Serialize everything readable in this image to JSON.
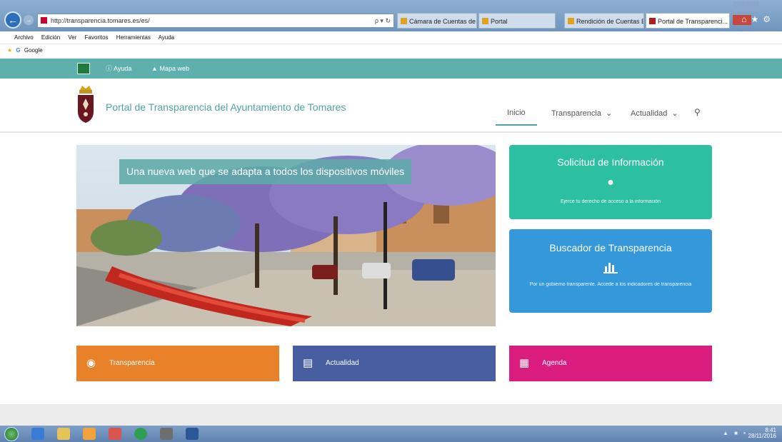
{
  "browser": {
    "address_url": "http://transparencia.tomares.es/es/",
    "address_controls": "ρ ▾ ↻",
    "tabs": [
      {
        "label": "Cámara de Cuentas de A..."
      },
      {
        "label": "Portal"
      },
      {
        "label": "Rendición de Cuentas Entid..."
      },
      {
        "label": "Portal de Transparenci..."
      }
    ],
    "menu": [
      "Archivo",
      "Edición",
      "Ver",
      "Favoritos",
      "Herramientas",
      "Ayuda"
    ],
    "favorites": [
      "Google"
    ]
  },
  "topbar": {
    "help_label": "Ayuda",
    "map_label": "Mapa web"
  },
  "header": {
    "title": "Portal de Transparencia del Ayuntamiento de Tomares",
    "nav": {
      "inicio": "Inicio",
      "transparencia": "Transparencia",
      "actualidad": "Actualidad"
    }
  },
  "hero": {
    "caption": "Una nueva web que se adapta a todos los dispositivos móviles"
  },
  "cards": {
    "info": {
      "title": "Solicitud de Información",
      "description": "Ejerce tu derecho de acceso a la información"
    },
    "search": {
      "title": "Buscador de Transparencia",
      "description": "Por un gobierno transparente. Accede a los indicadores de transparencia"
    }
  },
  "tiles": {
    "transparencia": "Transparencia",
    "actualidad": "Actualidad",
    "agenda": "Agenda"
  },
  "taskbar": {
    "time": "8:41",
    "date": "28/11/2016"
  },
  "colors": {
    "brand_teal": "#5fb0ac",
    "card_info": "#2cbfa1",
    "card_search": "#3498db",
    "tile_transparencia": "#e8822a",
    "tile_actualidad": "#475fa0",
    "tile_agenda": "#d91c7e"
  },
  "icons": {
    "topbar_help": "info-circle-icon",
    "topbar_map": "sitemap-icon",
    "nav_search": "search-icon",
    "info": "chat-bubble-icon",
    "search_card": "bar-chart-icon",
    "tile_transparencia": "eye-icon",
    "tile_actualidad": "newspaper-icon",
    "tile_agenda": "calendar-icon"
  }
}
